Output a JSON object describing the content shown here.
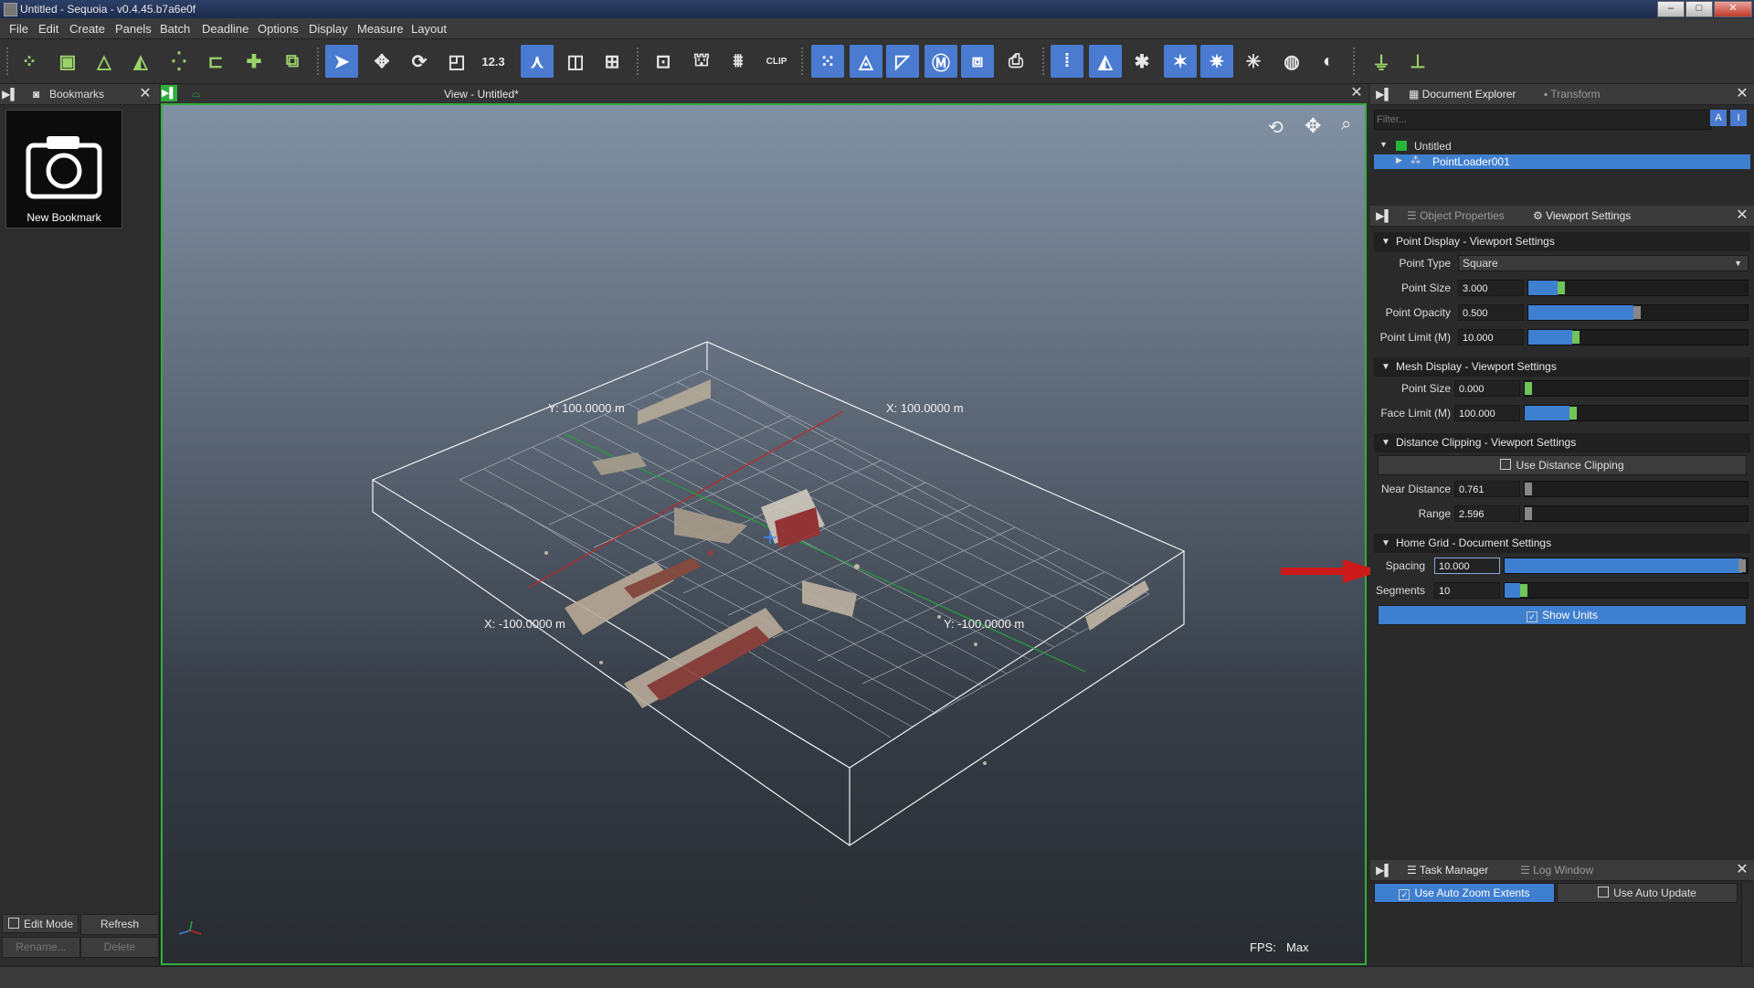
{
  "window": {
    "title": "Untitled - Sequoia - v0.4.45.b7a6e0f"
  },
  "menu": [
    "File",
    "Edit",
    "Create",
    "Panels",
    "Batch",
    "Deadline",
    "Options",
    "Display",
    "Measure",
    "Layout"
  ],
  "toolbar": {
    "buttons": [
      "point-loader",
      "mesh-loader",
      "mesh-creator",
      "mesh-creator-multi",
      "point-cloud",
      "point-sampler",
      "marker",
      "loader-multi",
      "select",
      "move",
      "rotate",
      "scale",
      "measure",
      "axes",
      "cube",
      "grid",
      "frame-selection",
      "point-export",
      "mesh-export",
      "clip",
      "points-visible",
      "mesh-visible",
      "hide",
      "mesh-toggle",
      "clip-mesh",
      "snapshot",
      "points-1",
      "points-2",
      "points-3",
      "points-4",
      "points-5",
      "light",
      "sphere",
      "sphere-shaded",
      "pivot",
      "pivot-reset"
    ],
    "measure_label": "12.3",
    "clip_label": "CLIP",
    "selected": [
      "select",
      "axes",
      "points-visible",
      "mesh-visible",
      "hide",
      "mesh-toggle",
      "clip-mesh",
      "points-1",
      "points-2",
      "points-4",
      "points-5"
    ]
  },
  "bookmarks": {
    "tab_label": "Bookmarks",
    "items": [
      {
        "label": "New Bookmark"
      }
    ],
    "edit_mode_label": "Edit Mode",
    "refresh_label": "Refresh",
    "rename_label": "Rename...",
    "delete_label": "Delete"
  },
  "viewport": {
    "title": "View - Untitled*",
    "axis_labels": {
      "y_pos": "Y: 100.0000  m",
      "x_pos": "X: 100.0000  m",
      "x_neg": "X: -100.0000  m",
      "y_neg": "Y: -100.0000  m"
    },
    "fps_label": "FPS:",
    "fps_value": "Max"
  },
  "document_explorer": {
    "tabs": [
      "Document Explorer",
      "Transform"
    ],
    "filter_placeholder": "Filter...",
    "filter_btn_a": "A",
    "filter_btn_i": "I",
    "tree": [
      {
        "label": "Untitled",
        "color": "#27b53a"
      },
      {
        "label": "PointLoader001",
        "selected": true
      }
    ]
  },
  "settings": {
    "tabs": [
      "Object Properties",
      "Viewport Settings"
    ],
    "point_display": {
      "header": "Point Display - Viewport Settings",
      "point_type_label": "Point Type",
      "point_type_value": "Square",
      "point_size_label": "Point Size",
      "point_size_value": "3.000",
      "point_size_level": 0.15,
      "point_opacity_label": "Point Opacity",
      "point_opacity_value": "0.500",
      "point_opacity_level": 0.5,
      "point_limit_label": "Point Limit (M)",
      "point_limit_value": "10.000",
      "point_limit_level": 0.22
    },
    "mesh_display": {
      "header": "Mesh Display - Viewport Settings",
      "point_size_label": "Point Size",
      "point_size_value": "0.000",
      "point_size_level": 0.0,
      "face_limit_label": "Face Limit (M)",
      "face_limit_value": "100.000",
      "face_limit_level": 0.22
    },
    "distance_clipping": {
      "header": "Distance Clipping - Viewport Settings",
      "use_label": "Use Distance Clipping",
      "near_label": "Near Distance",
      "near_value": "0.761",
      "range_label": "Range",
      "range_value": "2.596"
    },
    "home_grid": {
      "header": "Home Grid - Document Settings",
      "spacing_label": "Spacing",
      "spacing_value": "10.000",
      "spacing_level": 1.0,
      "segments_label": "Segments",
      "segments_value": "10",
      "segments_level": 0.08,
      "show_units_label": "Show Units"
    }
  },
  "task_manager": {
    "tabs": [
      "Task Manager",
      "Log Window"
    ],
    "auto_zoom_label": "Use Auto Zoom Extents",
    "auto_update_label": "Use Auto Update"
  },
  "colors": {
    "accent": "#3f7fd0",
    "viewport_border": "#2fae3c",
    "arrow": "#cc1a1a"
  }
}
